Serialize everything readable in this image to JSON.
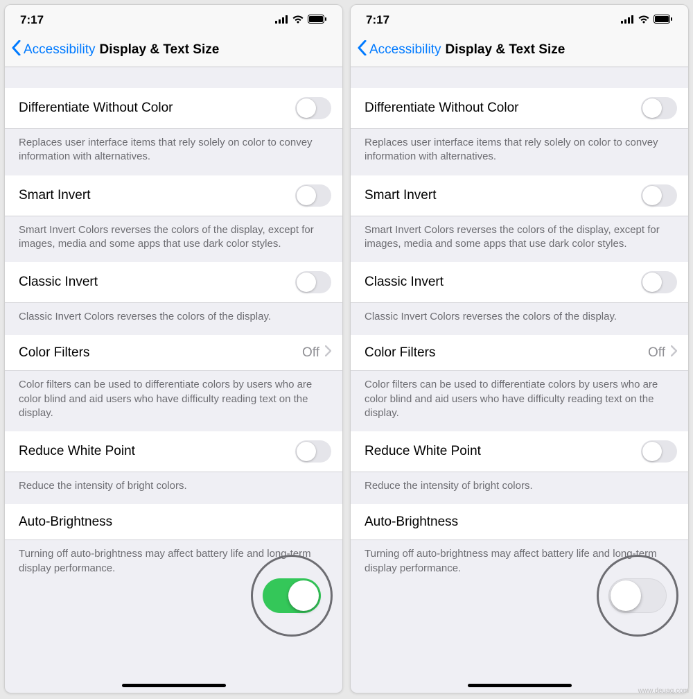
{
  "status": {
    "time": "7:17"
  },
  "nav": {
    "back": "Accessibility",
    "title": "Display & Text Size"
  },
  "rows": {
    "differentiate": {
      "label": "Differentiate Without Color",
      "footer": "Replaces user interface items that rely solely on color to convey information with alternatives."
    },
    "smartInvert": {
      "label": "Smart Invert",
      "footer": "Smart Invert Colors reverses the colors of the display, except for images, media and some apps that use dark color styles."
    },
    "classicInvert": {
      "label": "Classic Invert",
      "footer": "Classic Invert Colors reverses the colors of the display."
    },
    "colorFilters": {
      "label": "Color Filters",
      "value": "Off",
      "footer": "Color filters can be used to differentiate colors by users who are color blind and aid users who have difficulty reading text on the display."
    },
    "reduceWhitePoint": {
      "label": "Reduce White Point",
      "footer": "Reduce the intensity of bright colors."
    },
    "autoBrightness": {
      "label": "Auto-Brightness",
      "footer": "Turning off auto-brightness may affect battery life and long-term display performance."
    }
  },
  "screens": [
    {
      "autoBrightnessOn": true
    },
    {
      "autoBrightnessOn": false
    }
  ],
  "watermark": "www.deuaq.com"
}
